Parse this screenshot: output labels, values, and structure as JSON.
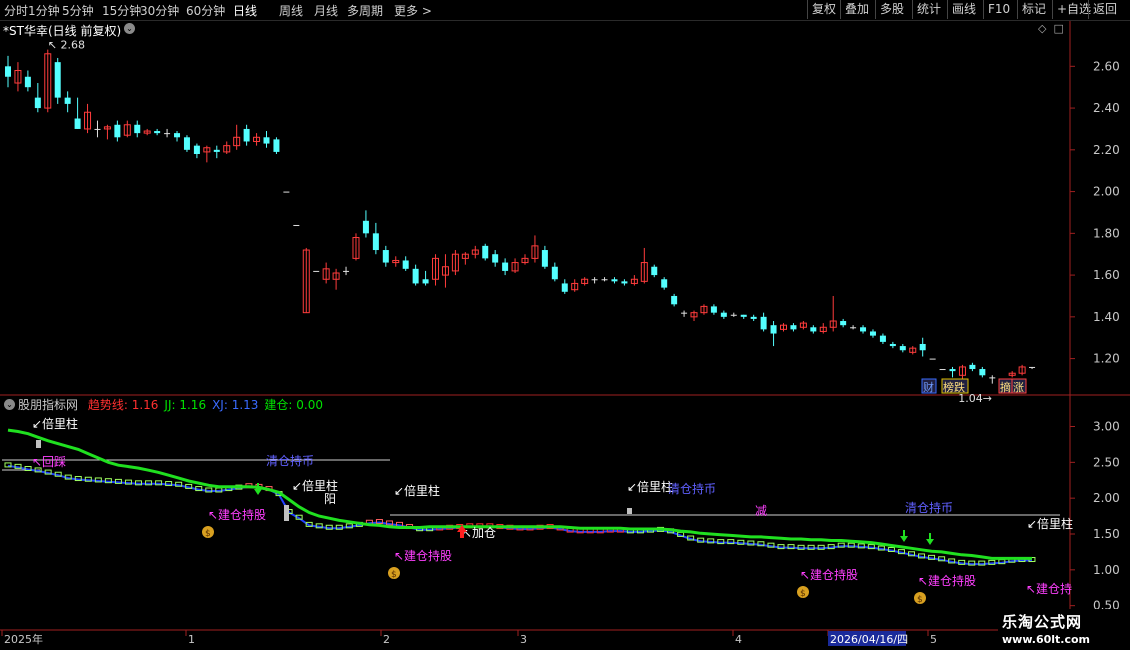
{
  "toolbar": {
    "periods": [
      "分时",
      "1分钟",
      "5分钟",
      "15分钟",
      "30分钟",
      "60分钟",
      "日线",
      "周线",
      "月线",
      "多周期",
      "更多 >"
    ],
    "active_period": "日线",
    "actions": [
      "复权",
      "叠加",
      "多股",
      "统计",
      "画线",
      "F10",
      "标记",
      "+自选",
      "返回"
    ]
  },
  "main_chart": {
    "title": "*ST华幸(日线 前复权)",
    "high_label": "2.68",
    "low_label": "1.04",
    "y_ticks": [
      "2.60",
      "2.40",
      "2.20",
      "2.00",
      "1.80",
      "1.60",
      "1.40",
      "1.20"
    ],
    "badges": [
      "财",
      "榜跌",
      "摘",
      "涨"
    ]
  },
  "sub_chart": {
    "name": "股朋指标网",
    "indicators": [
      {
        "label": "趋势线:",
        "value": "1.16",
        "color": "#ff3030"
      },
      {
        "label": "JJ:",
        "value": "1.16",
        "color": "#00e000"
      },
      {
        "label": "XJ:",
        "value": "1.13",
        "color": "#3a6bff"
      },
      {
        "label": "建仓:",
        "value": "0.00",
        "color": "#00e000"
      }
    ],
    "y_ticks": [
      "3.00",
      "2.50",
      "2.00",
      "1.50",
      "1.00",
      "0.50"
    ],
    "labels": {
      "beiliang": "倍里柱",
      "jiancang_chigu": "建仓持股",
      "jiacang": "加仓",
      "qingcang_chibi": "清仓持币",
      "huilu": "回踩",
      "yang": "阳",
      "jian": "减"
    }
  },
  "x_axis": {
    "labels": [
      "2025年",
      "1",
      "2",
      "3",
      "4",
      "2026/04/16/四",
      "5"
    ],
    "highlight_date": "2026/04/16/四"
  },
  "watermark": {
    "name": "乐淘公式网",
    "url": "www.60lt.com"
  },
  "chart_data": {
    "type": "candlestick",
    "title": "*ST华幸(日线 前复权)",
    "ylim": [
      1.04,
      2.75
    ],
    "y_ticks": [
      2.6,
      2.4,
      2.2,
      2.0,
      1.8,
      1.6,
      1.4,
      1.2
    ],
    "max": 2.68,
    "min": 1.04,
    "candles": [
      [
        2.6,
        2.55,
        2.5,
        2.65
      ],
      [
        2.52,
        2.58,
        2.48,
        2.62
      ],
      [
        2.55,
        2.5,
        2.48,
        2.58
      ],
      [
        2.45,
        2.4,
        2.38,
        2.52
      ],
      [
        2.4,
        2.66,
        2.38,
        2.68
      ],
      [
        2.62,
        2.45,
        2.42,
        2.64
      ],
      [
        2.45,
        2.42,
        2.38,
        2.48
      ],
      [
        2.35,
        2.3,
        2.3,
        2.45
      ],
      [
        2.3,
        2.38,
        2.28,
        2.42
      ],
      [
        2.3,
        2.3,
        2.26,
        2.34
      ],
      [
        2.3,
        2.31,
        2.25,
        2.32
      ],
      [
        2.32,
        2.26,
        2.24,
        2.34
      ],
      [
        2.27,
        2.32,
        2.26,
        2.34
      ],
      [
        2.32,
        2.28,
        2.26,
        2.34
      ],
      [
        2.28,
        2.29,
        2.27,
        2.3
      ],
      [
        2.29,
        2.28,
        2.27,
        2.3
      ],
      [
        2.28,
        2.28,
        2.26,
        2.3
      ],
      [
        2.28,
        2.26,
        2.24,
        2.29
      ],
      [
        2.26,
        2.2,
        2.19,
        2.27
      ],
      [
        2.22,
        2.18,
        2.16,
        2.23
      ],
      [
        2.19,
        2.21,
        2.14,
        2.22
      ],
      [
        2.2,
        2.19,
        2.16,
        2.22
      ],
      [
        2.19,
        2.22,
        2.18,
        2.24
      ],
      [
        2.22,
        2.26,
        2.2,
        2.32
      ],
      [
        2.3,
        2.24,
        2.22,
        2.32
      ],
      [
        2.24,
        2.26,
        2.22,
        2.28
      ],
      [
        2.26,
        2.23,
        2.21,
        2.29
      ],
      [
        2.25,
        2.19,
        2.18,
        2.26
      ],
      [
        2.0,
        2.0,
        2.0,
        2.0
      ],
      [
        1.84,
        1.84,
        1.84,
        1.84
      ],
      [
        1.42,
        1.72,
        1.42,
        1.73
      ],
      [
        1.62,
        1.62,
        1.62,
        1.62
      ],
      [
        1.58,
        1.63,
        1.56,
        1.66
      ],
      [
        1.58,
        1.61,
        1.53,
        1.63
      ],
      [
        1.62,
        1.62,
        1.6,
        1.64
      ],
      [
        1.68,
        1.78,
        1.67,
        1.8
      ],
      [
        1.86,
        1.8,
        1.78,
        1.91
      ],
      [
        1.8,
        1.72,
        1.7,
        1.85
      ],
      [
        1.72,
        1.66,
        1.64,
        1.74
      ],
      [
        1.66,
        1.67,
        1.64,
        1.69
      ],
      [
        1.67,
        1.63,
        1.62,
        1.69
      ],
      [
        1.63,
        1.56,
        1.55,
        1.65
      ],
      [
        1.58,
        1.56,
        1.55,
        1.62
      ],
      [
        1.58,
        1.68,
        1.55,
        1.7
      ],
      [
        1.6,
        1.64,
        1.54,
        1.7
      ],
      [
        1.62,
        1.7,
        1.6,
        1.72
      ],
      [
        1.68,
        1.7,
        1.65,
        1.71
      ],
      [
        1.7,
        1.72,
        1.68,
        1.74
      ],
      [
        1.74,
        1.68,
        1.67,
        1.75
      ],
      [
        1.7,
        1.66,
        1.64,
        1.72
      ],
      [
        1.66,
        1.62,
        1.6,
        1.68
      ],
      [
        1.62,
        1.66,
        1.61,
        1.68
      ],
      [
        1.66,
        1.68,
        1.65,
        1.7
      ],
      [
        1.68,
        1.74,
        1.66,
        1.79
      ],
      [
        1.72,
        1.64,
        1.63,
        1.74
      ],
      [
        1.64,
        1.58,
        1.57,
        1.66
      ],
      [
        1.56,
        1.52,
        1.51,
        1.58
      ],
      [
        1.53,
        1.56,
        1.52,
        1.58
      ],
      [
        1.56,
        1.58,
        1.55,
        1.59
      ],
      [
        1.58,
        1.58,
        1.56,
        1.59
      ],
      [
        1.58,
        1.58,
        1.57,
        1.59
      ],
      [
        1.58,
        1.57,
        1.56,
        1.59
      ],
      [
        1.57,
        1.56,
        1.55,
        1.58
      ],
      [
        1.56,
        1.58,
        1.55,
        1.6
      ],
      [
        1.57,
        1.66,
        1.56,
        1.73
      ],
      [
        1.64,
        1.6,
        1.59,
        1.65
      ],
      [
        1.58,
        1.54,
        1.53,
        1.59
      ],
      [
        1.5,
        1.46,
        1.45,
        1.51
      ],
      [
        1.42,
        1.42,
        1.4,
        1.43
      ],
      [
        1.4,
        1.42,
        1.38,
        1.43
      ],
      [
        1.42,
        1.45,
        1.41,
        1.46
      ],
      [
        1.45,
        1.42,
        1.41,
        1.46
      ],
      [
        1.42,
        1.4,
        1.39,
        1.43
      ],
      [
        1.41,
        1.41,
        1.4,
        1.42
      ],
      [
        1.41,
        1.4,
        1.39,
        1.41
      ],
      [
        1.4,
        1.39,
        1.38,
        1.41
      ],
      [
        1.4,
        1.34,
        1.33,
        1.42
      ],
      [
        1.36,
        1.32,
        1.26,
        1.38
      ],
      [
        1.34,
        1.36,
        1.33,
        1.37
      ],
      [
        1.36,
        1.34,
        1.33,
        1.37
      ],
      [
        1.35,
        1.37,
        1.34,
        1.38
      ],
      [
        1.35,
        1.33,
        1.32,
        1.36
      ],
      [
        1.33,
        1.35,
        1.32,
        1.37
      ],
      [
        1.35,
        1.38,
        1.33,
        1.5
      ],
      [
        1.38,
        1.36,
        1.35,
        1.39
      ],
      [
        1.35,
        1.35,
        1.34,
        1.36
      ],
      [
        1.35,
        1.33,
        1.32,
        1.36
      ],
      [
        1.33,
        1.31,
        1.3,
        1.34
      ],
      [
        1.31,
        1.28,
        1.27,
        1.32
      ],
      [
        1.27,
        1.26,
        1.25,
        1.28
      ],
      [
        1.26,
        1.24,
        1.23,
        1.27
      ],
      [
        1.23,
        1.25,
        1.22,
        1.26
      ],
      [
        1.27,
        1.24,
        1.21,
        1.3
      ],
      [
        1.2,
        1.2,
        1.2,
        1.2
      ],
      [
        1.15,
        1.15,
        1.15,
        1.15
      ],
      [
        1.15,
        1.14,
        1.11,
        1.16
      ],
      [
        1.12,
        1.16,
        1.1,
        1.17
      ],
      [
        1.17,
        1.15,
        1.14,
        1.18
      ],
      [
        1.15,
        1.12,
        1.11,
        1.16
      ],
      [
        1.11,
        1.11,
        1.08,
        1.12
      ],
      [
        1.09,
        1.07,
        1.04,
        1.1
      ],
      [
        1.12,
        1.13,
        1.11,
        1.14
      ],
      [
        1.13,
        1.16,
        1.12,
        1.17
      ],
      [
        1.16,
        1.16,
        1.15,
        1.16
      ]
    ],
    "indicator": {
      "ylim": [
        0.3,
        3.3
      ],
      "y_ticks": [
        3.0,
        2.5,
        2.0,
        1.5,
        1.0,
        0.5
      ],
      "series": [
        {
          "name": "趋势线",
          "color": "#ff3030",
          "last": 1.16
        },
        {
          "name": "JJ",
          "color": "#00e000",
          "last": 1.16
        },
        {
          "name": "XJ",
          "color": "#3a6bff",
          "last": 1.13
        },
        {
          "name": "建仓",
          "color": "#00e000",
          "last": 0.0
        }
      ],
      "jj_line": [
        2.95,
        2.93,
        2.9,
        2.85,
        2.8,
        2.76,
        2.72,
        2.68,
        2.62,
        2.56,
        2.5,
        2.46,
        2.44,
        2.42,
        2.39,
        2.36,
        2.32,
        2.28,
        2.24,
        2.21,
        2.18,
        2.16,
        2.16,
        2.16,
        2.16,
        2.15,
        2.12,
        2.08,
        1.98,
        1.88,
        1.8,
        1.75,
        1.72,
        1.69,
        1.67,
        1.65,
        1.63,
        1.62,
        1.6,
        1.59,
        1.59,
        1.59,
        1.6,
        1.6,
        1.6,
        1.6,
        1.6,
        1.6,
        1.6,
        1.6,
        1.6,
        1.6,
        1.6,
        1.6,
        1.6,
        1.6,
        1.59,
        1.58,
        1.58,
        1.58,
        1.58,
        1.58,
        1.57,
        1.57,
        1.57,
        1.57,
        1.56,
        1.54,
        1.53,
        1.51,
        1.5,
        1.49,
        1.48,
        1.47,
        1.46,
        1.46,
        1.45,
        1.44,
        1.43,
        1.43,
        1.42,
        1.42,
        1.41,
        1.41,
        1.4,
        1.39,
        1.38,
        1.36,
        1.34,
        1.32,
        1.3,
        1.28,
        1.26,
        1.25,
        1.23,
        1.21,
        1.2,
        1.18,
        1.16,
        1.16,
        1.16,
        1.16,
        1.16
      ],
      "xj_line": [
        2.45,
        2.43,
        2.4,
        2.38,
        2.35,
        2.32,
        2.28,
        2.26,
        2.25,
        2.24,
        2.23,
        2.22,
        2.21,
        2.2,
        2.2,
        2.2,
        2.19,
        2.18,
        2.15,
        2.12,
        2.1,
        2.1,
        2.12,
        2.14,
        2.16,
        2.15,
        2.12,
        2.05,
        1.8,
        1.72,
        1.62,
        1.6,
        1.58,
        1.58,
        1.6,
        1.62,
        1.65,
        1.66,
        1.64,
        1.62,
        1.59,
        1.56,
        1.56,
        1.57,
        1.58,
        1.59,
        1.6,
        1.6,
        1.6,
        1.59,
        1.58,
        1.57,
        1.57,
        1.58,
        1.59,
        1.57,
        1.54,
        1.53,
        1.53,
        1.53,
        1.54,
        1.54,
        1.53,
        1.53,
        1.54,
        1.55,
        1.53,
        1.48,
        1.43,
        1.4,
        1.39,
        1.38,
        1.38,
        1.37,
        1.36,
        1.35,
        1.33,
        1.31,
        1.31,
        1.3,
        1.3,
        1.3,
        1.31,
        1.33,
        1.33,
        1.32,
        1.31,
        1.29,
        1.27,
        1.24,
        1.21,
        1.18,
        1.16,
        1.14,
        1.11,
        1.09,
        1.08,
        1.08,
        1.09,
        1.1,
        1.12,
        1.13,
        1.13
      ]
    }
  }
}
